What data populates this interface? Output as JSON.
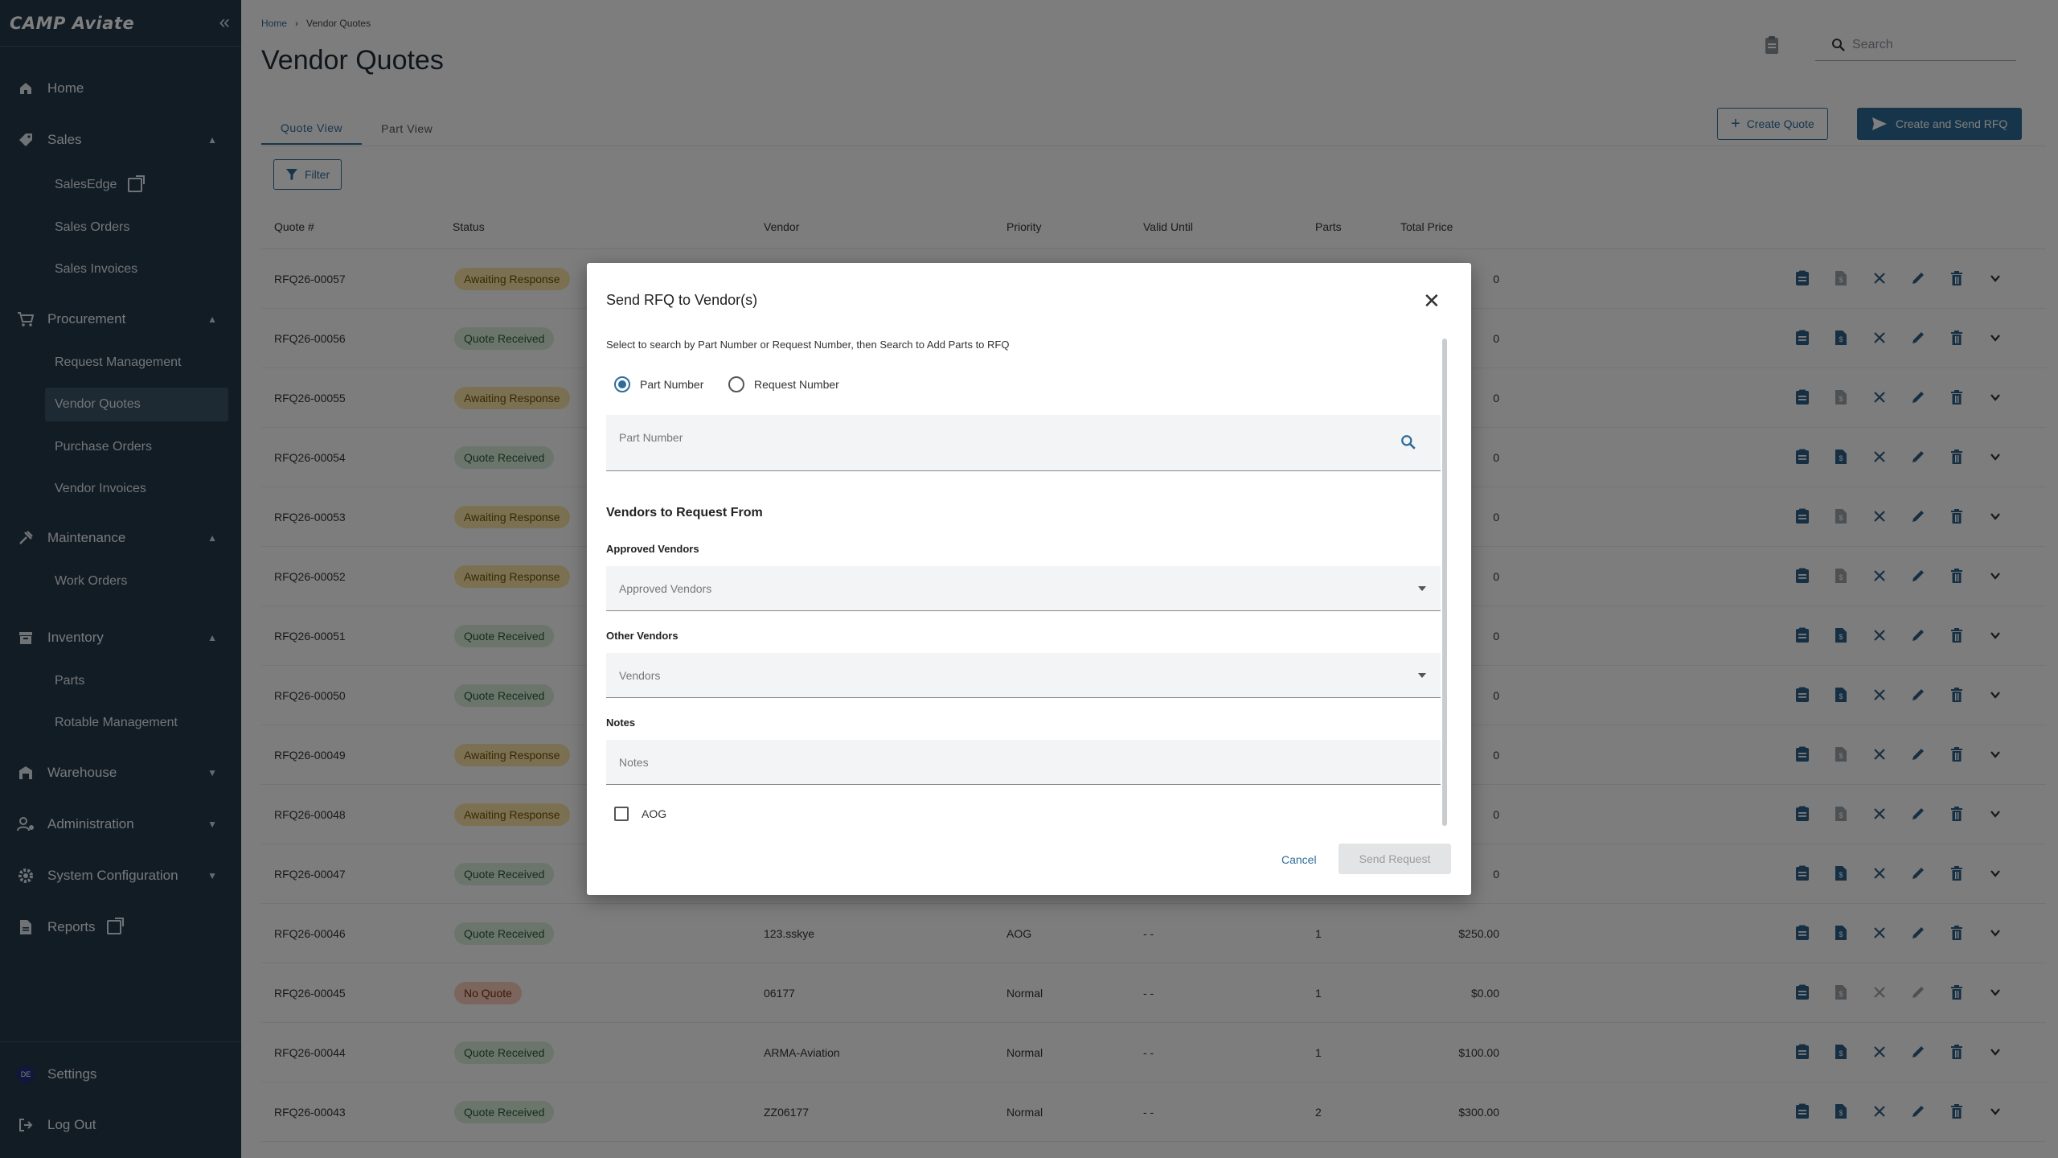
{
  "sidebar": {
    "logo": "CAMP Aviate",
    "items": {
      "home": "Home",
      "sales": "Sales",
      "salesedge": "SalesEdge",
      "sales_orders": "Sales Orders",
      "sales_invoices": "Sales Invoices",
      "procurement": "Procurement",
      "request_management": "Request Management",
      "vendor_quotes": "Vendor Quotes",
      "purchase_orders": "Purchase Orders",
      "vendor_invoices": "Vendor Invoices",
      "maintenance": "Maintenance",
      "work_orders": "Work Orders",
      "inventory": "Inventory",
      "parts": "Parts",
      "rotable_management": "Rotable Management",
      "warehouse": "Warehouse",
      "administration": "Administration",
      "system_configuration": "System Configuration",
      "reports": "Reports"
    },
    "settings": "Settings",
    "avatar_initials": "DE",
    "logout": "Log Out"
  },
  "header": {
    "breadcrumb_home": "Home",
    "breadcrumb_current": "Vendor Quotes",
    "title": "Vendor Quotes",
    "search_placeholder": "Search"
  },
  "tabs": {
    "quote_view": "Quote View",
    "part_view": "Part View"
  },
  "toolbar": {
    "filter": "Filter",
    "create_quote": "Create Quote",
    "create_send_rfq": "Create and Send RFQ"
  },
  "table": {
    "headers": {
      "quote": "Quote #",
      "status": "Status",
      "vendor": "Vendor",
      "priority": "Priority",
      "valid_until": "Valid Until",
      "parts": "Parts",
      "total_price": "Total Price"
    },
    "rows": [
      {
        "quote": "RFQ26-00057",
        "status": "Awaiting Response",
        "vendor": "",
        "priority": "",
        "valid": "",
        "parts": "",
        "total": "0"
      },
      {
        "quote": "RFQ26-00056",
        "status": "Quote Received",
        "vendor": "",
        "priority": "",
        "valid": "",
        "parts": "",
        "total": "0"
      },
      {
        "quote": "RFQ26-00055",
        "status": "Awaiting Response",
        "vendor": "",
        "priority": "",
        "valid": "",
        "parts": "",
        "total": "0"
      },
      {
        "quote": "RFQ26-00054",
        "status": "Quote Received",
        "vendor": "",
        "priority": "",
        "valid": "",
        "parts": "",
        "total": "0"
      },
      {
        "quote": "RFQ26-00053",
        "status": "Awaiting Response",
        "vendor": "",
        "priority": "",
        "valid": "",
        "parts": "",
        "total": "0"
      },
      {
        "quote": "RFQ26-00052",
        "status": "Awaiting Response",
        "vendor": "",
        "priority": "",
        "valid": "",
        "parts": "",
        "total": "0"
      },
      {
        "quote": "RFQ26-00051",
        "status": "Quote Received",
        "vendor": "",
        "priority": "",
        "valid": "",
        "parts": "",
        "total": "0"
      },
      {
        "quote": "RFQ26-00050",
        "status": "Quote Received",
        "vendor": "",
        "priority": "",
        "valid": "",
        "parts": "",
        "total": "0"
      },
      {
        "quote": "RFQ26-00049",
        "status": "Awaiting Response",
        "vendor": "",
        "priority": "",
        "valid": "",
        "parts": "",
        "total": "0"
      },
      {
        "quote": "RFQ26-00048",
        "status": "Awaiting Response",
        "vendor": "",
        "priority": "",
        "valid": "",
        "parts": "",
        "total": "0"
      },
      {
        "quote": "RFQ26-00047",
        "status": "Quote Received",
        "vendor": "",
        "priority": "",
        "valid": "",
        "parts": "",
        "total": "0"
      },
      {
        "quote": "RFQ26-00046",
        "status": "Quote Received",
        "vendor": "123.sskye",
        "priority": "AOG",
        "valid": "- -",
        "parts": "1",
        "total": "$250.00"
      },
      {
        "quote": "RFQ26-00045",
        "status": "No Quote",
        "vendor": "06177",
        "priority": "Normal",
        "valid": "- -",
        "parts": "1",
        "total": "$0.00"
      },
      {
        "quote": "RFQ26-00044",
        "status": "Quote Received",
        "vendor": "ARMA-Aviation",
        "priority": "Normal",
        "valid": "- -",
        "parts": "1",
        "total": "$100.00"
      },
      {
        "quote": "RFQ26-00043",
        "status": "Quote Received",
        "vendor": "ZZ06177",
        "priority": "Normal",
        "valid": "- -",
        "parts": "2",
        "total": "$300.00"
      }
    ]
  },
  "modal": {
    "title": "Send RFQ to Vendor(s)",
    "instructions": "Select to search by Part Number or Request Number, then Search to Add Parts to RFQ",
    "radio_part": "Part Number",
    "radio_request": "Request Number",
    "part_placeholder": "Part Number",
    "vendors_heading": "Vendors to Request From",
    "approved_label": "Approved Vendors",
    "approved_placeholder": "Approved Vendors",
    "other_label": "Other Vendors",
    "other_placeholder": "Vendors",
    "notes_label": "Notes",
    "notes_placeholder": "Notes",
    "aog": "AOG",
    "cancel": "Cancel",
    "send": "Send Request"
  },
  "colors": {
    "sidebar": "#24394a",
    "accent": "#2e6d99",
    "awaiting": "#f7e3a4",
    "received": "#d7ead9",
    "no_quote": "#f9cbb9"
  }
}
